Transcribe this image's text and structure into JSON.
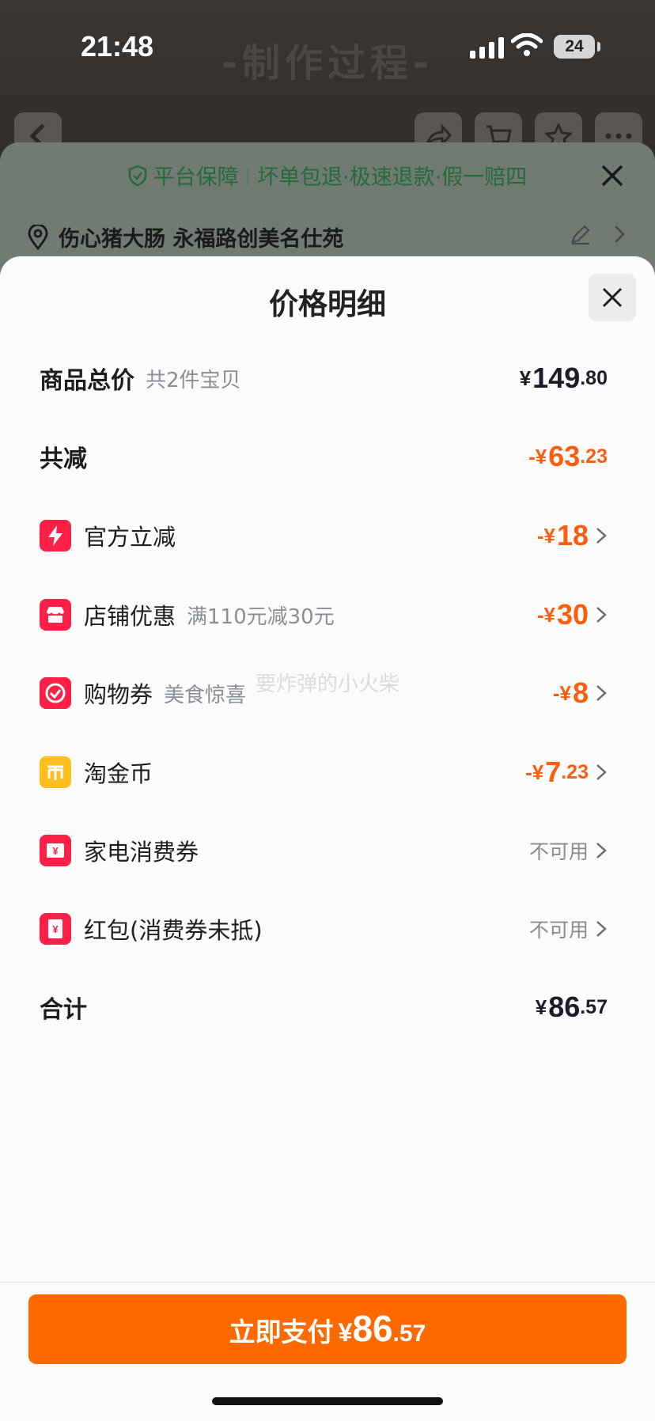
{
  "status": {
    "time": "21:48",
    "battery": "24"
  },
  "background": {
    "title": "-制作过程-"
  },
  "guarantee": {
    "shield": "平台保障",
    "terms": "坏单包退·极速退款·假一赔四"
  },
  "address": {
    "text": "伤心猪大肠 永福路创美名仕苑"
  },
  "modal": {
    "title": "价格明细"
  },
  "rows": {
    "total": {
      "label": "商品总价",
      "sub": "共2件宝贝",
      "yen": "¥",
      "int": "149",
      "dec": ".80"
    },
    "reduce": {
      "label": "共减",
      "yen": "-¥",
      "int": "63",
      "dec": ".23"
    },
    "official": {
      "label": "官方立减",
      "yen": "-¥",
      "int": "18",
      "dec": ""
    },
    "shop": {
      "label": "店铺优惠",
      "sub": "满110元减30元",
      "yen": "-¥",
      "int": "30",
      "dec": ""
    },
    "coupon": {
      "label": "购物券",
      "sub": "美食惊喜",
      "yen": "-¥",
      "int": "8",
      "dec": ""
    },
    "coin": {
      "label": "淘金币",
      "yen": "-¥",
      "int": "7",
      "dec": ".23"
    },
    "appliance": {
      "label": "家电消费券",
      "status": "不可用"
    },
    "redpacket": {
      "label": "红包(消费券未抵)",
      "status": "不可用"
    },
    "sum": {
      "label": "合计",
      "yen": "¥",
      "int": "86",
      "dec": ".57"
    }
  },
  "watermark": "要炸弹的小火柴",
  "pay": {
    "label": "立即支付",
    "yen": "¥",
    "int": "86",
    "dec": ".57"
  },
  "colors": {
    "accent": "#ff6a00",
    "discount": "#ff5d0d",
    "guarantee": "#236b3a",
    "icon_red": "#ff2047",
    "icon_yellow": "#ffbe1e"
  }
}
